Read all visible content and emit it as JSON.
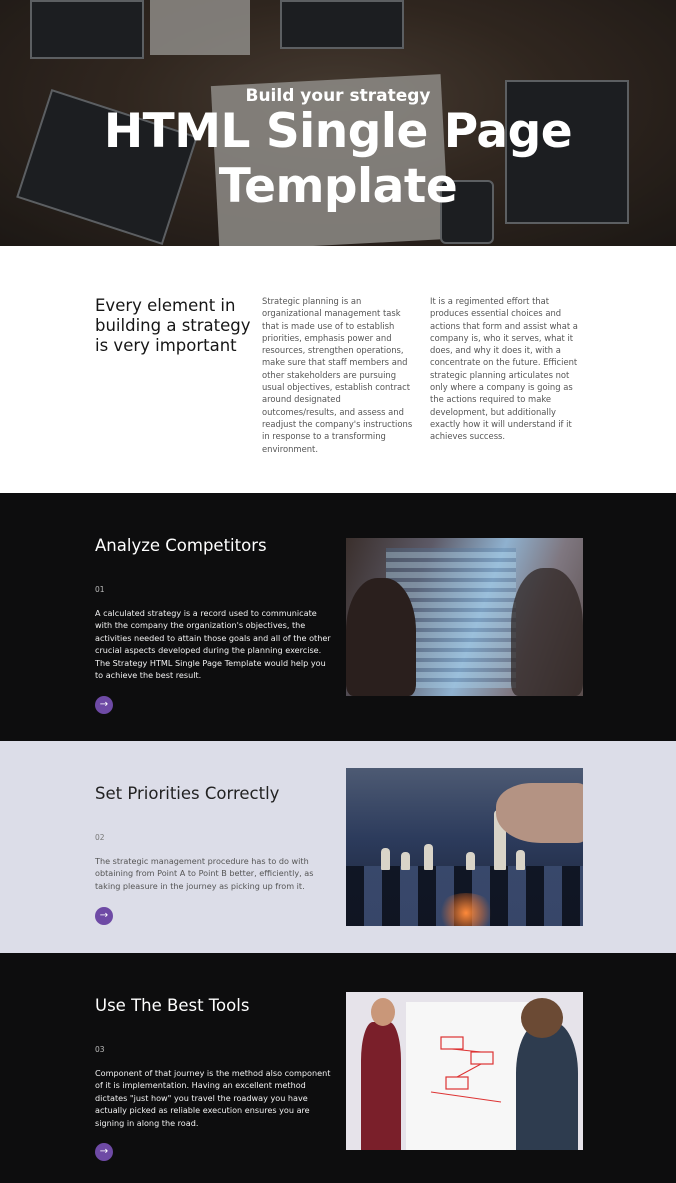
{
  "hero": {
    "subtitle": "Build your strategy",
    "title": "HTML Single Page Template"
  },
  "intro": {
    "heading": "Every element in building a strategy is very important",
    "col1": "Strategic planning is an organizational management task that is made use of to establish priorities, emphasis power and resources, strengthen operations, make sure that staff members and other stakeholders are pursuing usual objectives, establish contract around designated outcomes/results, and assess and readjust the company's instructions in response to a transforming environment.",
    "col2": "It is a regimented effort that produces essential choices and actions that form and assist what a company is, who it serves, what it does, and why it does it, with a concentrate on the future. Efficient strategic planning articulates not only where a company is going as the actions required to make development, but additionally exactly how it will understand if it achieves success."
  },
  "features": [
    {
      "title": "Analyze Competitors",
      "number": "01",
      "text": "A calculated strategy is a record used to communicate with the company the organization's objectives, the activities needed to attain those goals and all of the other crucial aspects developed during the planning exercise. The Strategy HTML Single Page Template would help you to achieve the best result.",
      "arrow": "→"
    },
    {
      "title": "Set Priorities Correctly",
      "number": "02",
      "text": "The strategic management procedure has to do with obtaining from Point A to Point B better, efficiently, as taking pleasure in the journey as picking up from it.",
      "arrow": "→"
    },
    {
      "title": "Use The Best Tools",
      "number": "03",
      "text": "Component of that journey is the method also component of it is implementation. Having an excellent method dictates \"just how\" you travel the roadway you have actually picked as reliable execution ensures you are signing in along the road.",
      "arrow": "→"
    }
  ],
  "colors": {
    "dark_bg": "#0d0d0e",
    "light_bg": "#dcdde8",
    "accent": "#6e4aa5"
  }
}
